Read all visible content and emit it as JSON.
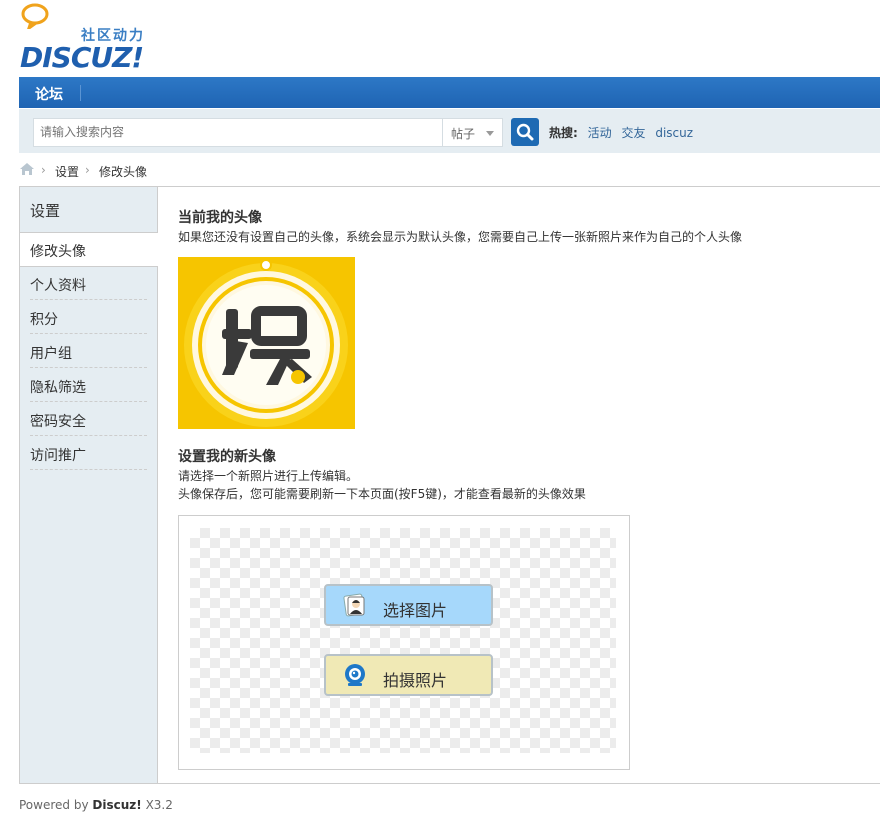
{
  "header": {
    "tagline": "社区动力",
    "brand": "DISCUZ!",
    "nav": {
      "forum_label": "论坛"
    }
  },
  "search": {
    "placeholder": "请输入搜索内容",
    "type_label": "帖子",
    "hot_label": "热搜:",
    "hot_links": [
      "活动",
      "交友",
      "discuz"
    ]
  },
  "breadcrumb": {
    "items": [
      "设置",
      "修改头像"
    ]
  },
  "sidebar": {
    "title": "设置",
    "active_item": "修改头像",
    "items": [
      "个人资料",
      "积分",
      "用户组",
      "隐私筛选",
      "密码安全",
      "访问推广"
    ]
  },
  "current_avatar": {
    "heading": "当前我的头像",
    "note": "如果您还没有设置自己的头像，系统会显示为默认头像，您需要自己上传一张新照片来作为自己的个人头像"
  },
  "new_avatar": {
    "heading": "设置我的新头像",
    "note_line1": "请选择一个新照片进行上传编辑。",
    "note_line2": "头像保存后，您可能需要刷新一下本页面(按F5键)，才能查看最新的头像效果",
    "select_button": "选择图片",
    "camera_button": "拍摄照片"
  },
  "footer": {
    "powered_prefix": "Powered by",
    "powered_brand": "Discuz!",
    "powered_version": "X3.2"
  },
  "colors": {
    "nav_blue": "#1f64b3",
    "search_bg": "#e5edf2",
    "select_btn": "#a6d8fb",
    "camera_btn": "#f0e9b5",
    "avatar_yellow": "#f6c500"
  }
}
